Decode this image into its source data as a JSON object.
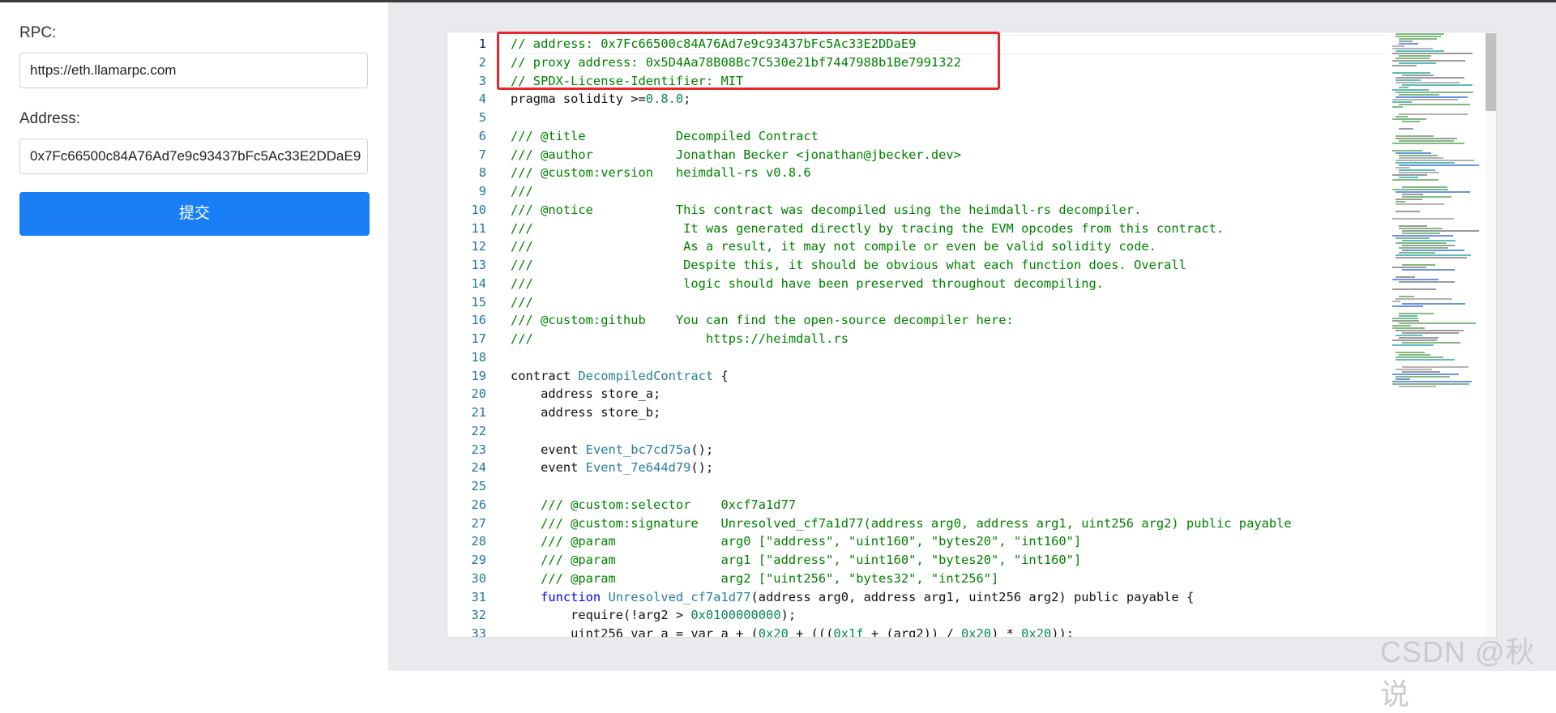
{
  "form": {
    "rpc_label": "RPC:",
    "rpc_value": "https://eth.llamarpc.com",
    "address_label": "Address:",
    "address_value": "0x7Fc66500c84A76Ad7e9c93437bFc5Ac33E2DDaE9",
    "submit_label": "提交"
  },
  "editor": {
    "active_line": 1,
    "lines": [
      [
        [
          "c",
          "// address: 0x7Fc66500c84A76Ad7e9c93437bFc5Ac33E2DDaE9"
        ]
      ],
      [
        [
          "c",
          "// proxy address: 0x5D4Aa78B08Bc7C530e21bf7447988b1Be7991322"
        ]
      ],
      [
        [
          "c",
          "// SPDX-License-Identifier: MIT"
        ]
      ],
      [
        [
          "p",
          "pragma solidity >="
        ],
        [
          "n",
          "0.8.0"
        ],
        [
          "p",
          ";"
        ]
      ],
      [],
      [
        [
          "c",
          "/// @title            Decompiled Contract"
        ]
      ],
      [
        [
          "c",
          "/// @author           Jonathan Becker <jonathan@jbecker.dev>"
        ]
      ],
      [
        [
          "c",
          "/// @custom:version   heimdall-rs v0.8.6"
        ]
      ],
      [
        [
          "c",
          "///"
        ]
      ],
      [
        [
          "c",
          "/// @notice           This contract was decompiled using the heimdall-rs decompiler."
        ]
      ],
      [
        [
          "c",
          "///                    It was generated directly by tracing the EVM opcodes from this contract."
        ]
      ],
      [
        [
          "c",
          "///                    As a result, it may not compile or even be valid solidity code."
        ]
      ],
      [
        [
          "c",
          "///                    Despite this, it should be obvious what each function does. Overall"
        ]
      ],
      [
        [
          "c",
          "///                    logic should have been preserved throughout decompiling."
        ]
      ],
      [
        [
          "c",
          "///"
        ]
      ],
      [
        [
          "c",
          "/// @custom:github    You can find the open-source decompiler here:"
        ]
      ],
      [
        [
          "c",
          "///                       https://heimdall.rs"
        ]
      ],
      [],
      [
        [
          "p",
          "contract "
        ],
        [
          "t",
          "DecompiledContract"
        ],
        [
          "p",
          " {"
        ]
      ],
      [
        [
          "p",
          "    address store_a;"
        ]
      ],
      [
        [
          "p",
          "    address store_b;"
        ]
      ],
      [],
      [
        [
          "p",
          "    event "
        ],
        [
          "t",
          "Event_bc7cd75a"
        ],
        [
          "p",
          "();"
        ]
      ],
      [
        [
          "p",
          "    event "
        ],
        [
          "t",
          "Event_7e644d79"
        ],
        [
          "p",
          "();"
        ]
      ],
      [],
      [
        [
          "c",
          "    /// @custom:selector    0xcf7a1d77"
        ]
      ],
      [
        [
          "c",
          "    /// @custom:signature   Unresolved_cf7a1d77(address arg0, address arg1, uint256 arg2) public payable"
        ]
      ],
      [
        [
          "c",
          "    /// @param              arg0 [\"address\", \"uint160\", \"bytes20\", \"int160\"]"
        ]
      ],
      [
        [
          "c",
          "    /// @param              arg1 [\"address\", \"uint160\", \"bytes20\", \"int160\"]"
        ]
      ],
      [
        [
          "c",
          "    /// @param              arg2 [\"uint256\", \"bytes32\", \"int256\"]"
        ]
      ],
      [
        [
          "k",
          "    function "
        ],
        [
          "t",
          "Unresolved_cf7a1d77"
        ],
        [
          "p",
          "(address arg0, address arg1, uint256 arg2) public payable {"
        ]
      ],
      [
        [
          "p",
          "        require(!arg2 > "
        ],
        [
          "n",
          "0x0100000000"
        ],
        [
          "p",
          ");"
        ]
      ],
      [
        [
          "p",
          "        uint256 var_a = var_a + ("
        ],
        [
          "n",
          "0x20"
        ],
        [
          "p",
          " + ((("
        ],
        [
          "n",
          "0x1f"
        ],
        [
          "p",
          " + (arg2)) / "
        ],
        [
          "n",
          "0x20"
        ],
        [
          "p",
          ") * "
        ],
        [
          "n",
          "0x20"
        ],
        [
          "p",
          "));"
        ]
      ]
    ]
  },
  "watermark": "CSDN @秋说"
}
